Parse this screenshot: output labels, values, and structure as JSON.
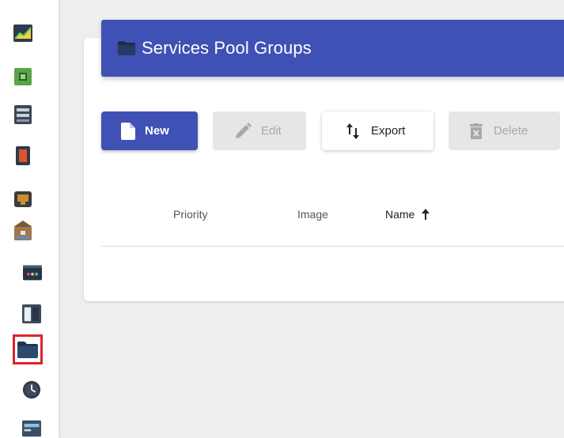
{
  "sidebar": {
    "items": [
      {
        "icon": "dashboard-chart-icon"
      },
      {
        "icon": "circuit-board-icon"
      },
      {
        "icon": "server-icon"
      },
      {
        "icon": "red-device-icon"
      },
      {
        "icon": "network-port-icon"
      },
      {
        "icon": "toolbox-icon"
      },
      {
        "icon": "terminal-window-icon"
      },
      {
        "icon": "split-panel-icon"
      },
      {
        "icon": "folder-icon",
        "selected": true
      },
      {
        "icon": "clock-icon"
      },
      {
        "icon": "card-icon"
      }
    ]
  },
  "header": {
    "title": "Services Pool Groups",
    "icon": "folder-icon"
  },
  "toolbar": {
    "new_label": "New",
    "edit_label": "Edit",
    "export_label": "Export",
    "delete_label": "Delete"
  },
  "table": {
    "columns": [
      {
        "label": "Priority"
      },
      {
        "label": "Image"
      },
      {
        "label": "Name",
        "sort": "ascending"
      }
    ]
  },
  "colors": {
    "primary": "#3f51b5",
    "selection_outline": "#e0212b",
    "disabled_bg": "#e6e6e6",
    "background": "#eeeeee"
  }
}
